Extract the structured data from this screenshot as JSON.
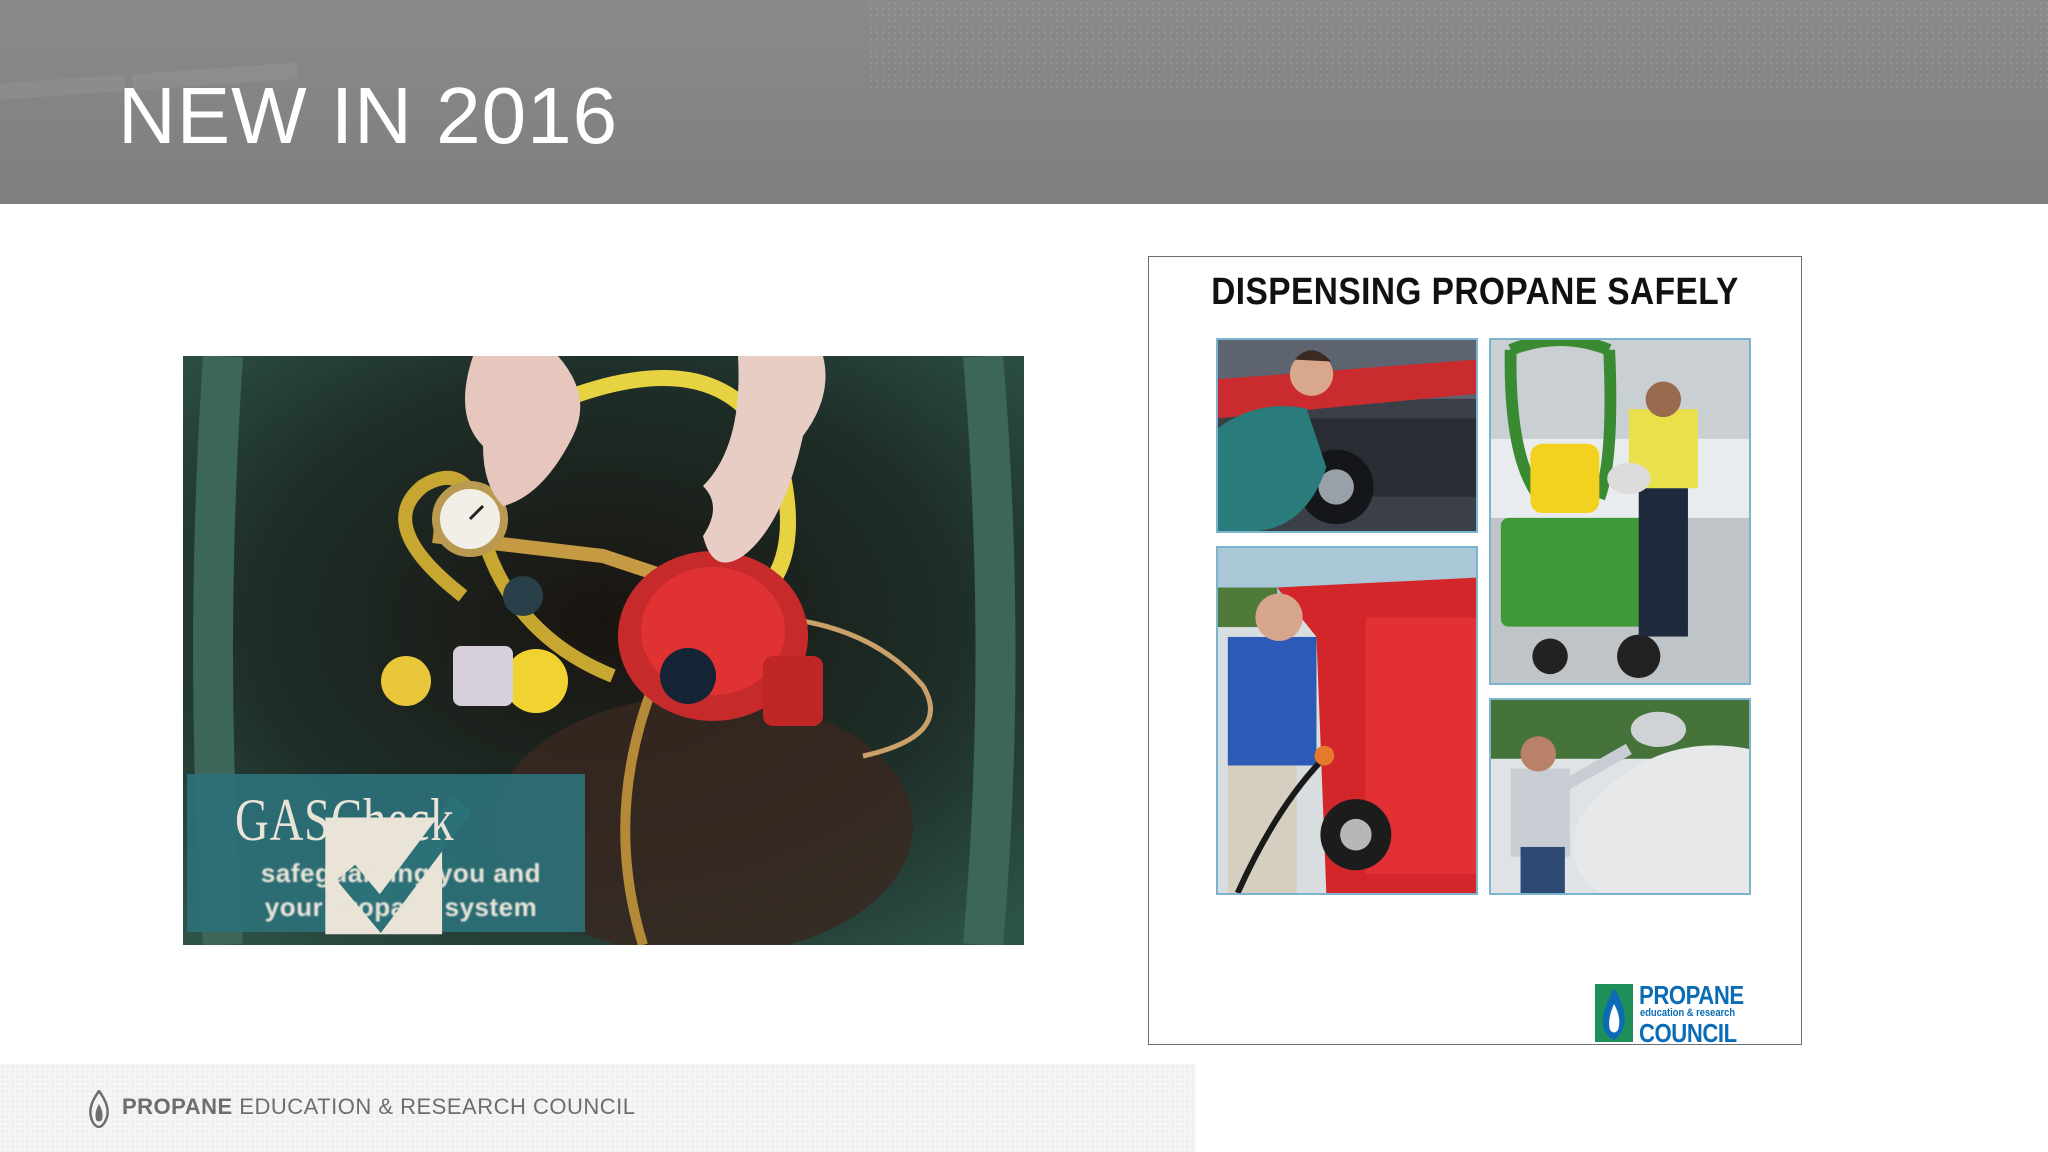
{
  "slide": {
    "title": "NEW IN 2016",
    "background_color": "#ffffff",
    "header_color": "#848587"
  },
  "left_image": {
    "overlay_title": "GASCheck",
    "overlay_subtitle_line1": "safeguarding you and",
    "overlay_subtitle_line2": "your propane system",
    "overlay_color": "#2c7078"
  },
  "brochure": {
    "title": "DISPENSING PROPANE SAFELY",
    "tile_border_color": "#7bb4cc",
    "logo": {
      "line1": "PROPANE",
      "line2": "education & research",
      "line3": "COUNCIL",
      "color": "#0a6cb4"
    }
  },
  "footer": {
    "org_bold": "PROPANE",
    "org_rest": "EDUCATION & RESEARCH COUNCIL",
    "icon": "propane-flame-icon"
  }
}
